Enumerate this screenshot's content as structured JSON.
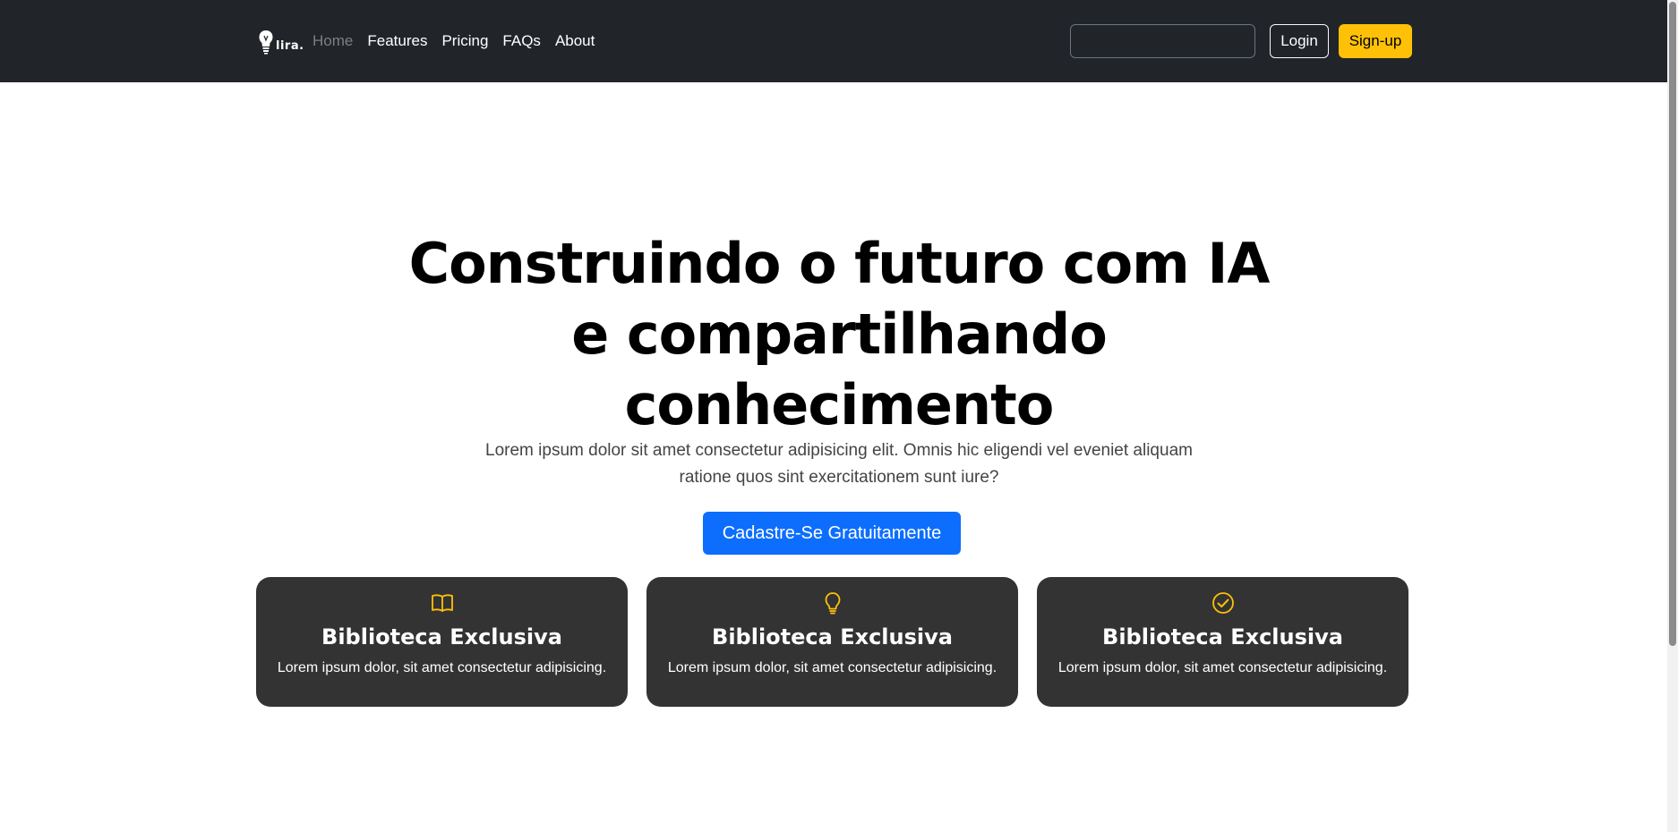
{
  "brand": {
    "logo_text": "lira.",
    "accent_color": "#ffc107"
  },
  "nav": {
    "links": [
      {
        "label": "Home",
        "active": true
      },
      {
        "label": "Features"
      },
      {
        "label": "Pricing"
      },
      {
        "label": "FAQs"
      },
      {
        "label": "About"
      }
    ],
    "search": {
      "value": "",
      "placeholder": ""
    },
    "login_label": "Login",
    "signup_label": "Sign-up"
  },
  "hero": {
    "title": "Construindo o futuro com IA e compartilhando conhecimento",
    "subtitle": "Lorem ipsum dolor sit amet consectetur adipisicing elit. Omnis hic eligendi vel eveniet aliquam ratione quos sint exercitationem sunt iure?",
    "cta_label": "Cadastre-Se Gratuitamente",
    "cta_color": "#0d6efd"
  },
  "features": [
    {
      "icon": "book-icon",
      "title": "Biblioteca Exclusiva",
      "text": "Lorem ipsum dolor, sit amet consectetur adipisicing."
    },
    {
      "icon": "lightbulb-icon",
      "title": "Biblioteca Exclusiva",
      "text": "Lorem ipsum dolor, sit amet consectetur adipisicing."
    },
    {
      "icon": "check-circle-icon",
      "title": "Biblioteca Exclusiva",
      "text": "Lorem ipsum dolor, sit amet consectetur adipisicing."
    }
  ]
}
